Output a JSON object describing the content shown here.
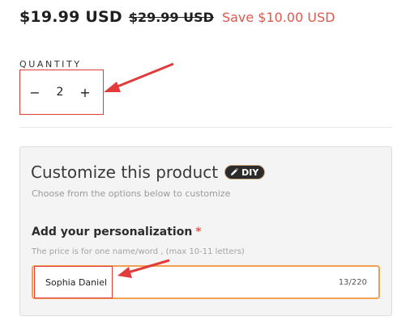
{
  "price": {
    "current": "$19.99 USD",
    "compare_at": "$29.99 USD",
    "savings": "Save $10.00 USD"
  },
  "quantity": {
    "label": "QUANTITY",
    "decrease_symbol": "−",
    "increase_symbol": "+",
    "value": "2"
  },
  "customize": {
    "title": "Customize this product",
    "badge": "DIY",
    "badge_icon": "pencil-icon",
    "subtitle": "Choose from the options below to customize",
    "personalization": {
      "label": "Add your personalization",
      "required_mark": "*",
      "hint": "The price is for one name/word , (max 10-11 letters)",
      "value": "Sophia Daniel",
      "counter": "13/220"
    }
  },
  "colors": {
    "accent_red": "#e2574c",
    "annotation_red": "#e23b3b",
    "field_focus_orange": "#f0a050",
    "badge_dark": "#2b2b2b"
  }
}
